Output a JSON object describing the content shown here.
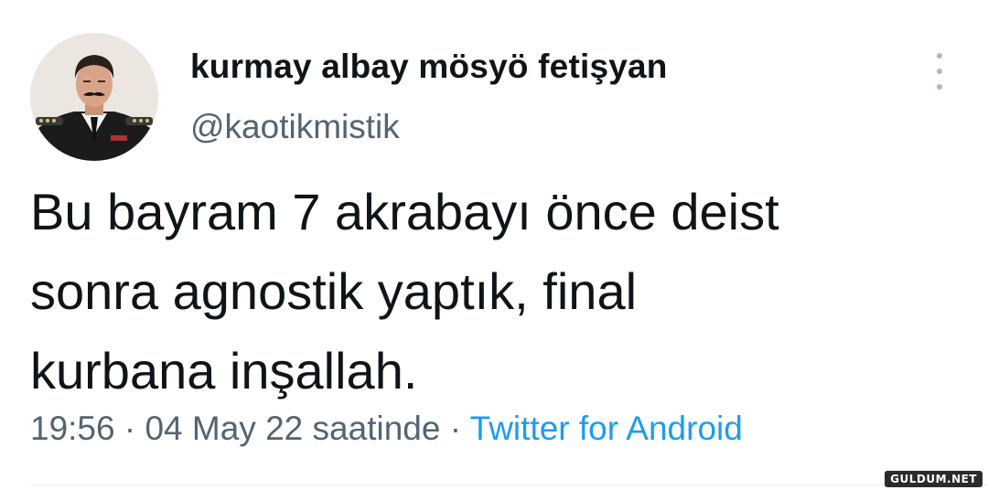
{
  "tweet": {
    "display_name": "kurmay albay mösyö fetişyan",
    "handle": "@kaotikmistik",
    "text": "Bu bayram 7 akrabayı önce deist\nsonra agnostik yaptık, final\nkurbana inşallah.",
    "time": "19:56",
    "separator": " · ",
    "date": "04 May 22 saatinde",
    "source": "Twitter for Android",
    "more_icon": "more-options-icon"
  },
  "watermark": "GULDUM.NET",
  "colors": {
    "text": "#0f1419",
    "secondary": "#536471",
    "link": "#1d9bf0",
    "background": "#ffffff"
  }
}
